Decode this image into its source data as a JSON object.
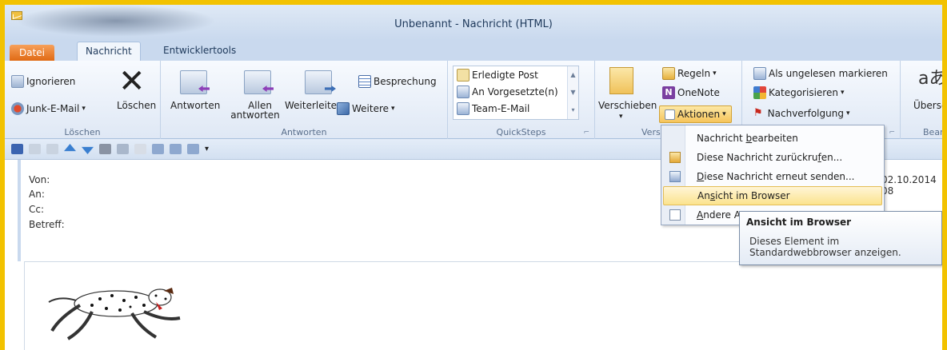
{
  "window": {
    "title": "Unbenannt - Nachricht (HTML)"
  },
  "tabs": [
    {
      "label": "Datei"
    },
    {
      "label": "Nachricht"
    },
    {
      "label": "Entwicklertools"
    }
  ],
  "ribbon": {
    "loeschen": {
      "group_label": "Löschen",
      "ignorieren": "Ignorieren",
      "junk": "Junk-E-Mail",
      "junk_arrow": "▾",
      "loeschen_btn": "Löschen"
    },
    "antworten": {
      "group_label": "Antworten",
      "antworten_btn": "Antworten",
      "allen_antworten_line1": "Allen",
      "allen_antworten_line2": "antworten",
      "weiterleiten": "Weiterleiten",
      "besprechung": "Besprechung",
      "weitere": "Weitere",
      "weitere_arrow": "▾"
    },
    "quicksteps": {
      "group_label": "QuickSteps",
      "items": [
        {
          "label": "Erledigte Post"
        },
        {
          "label": "An Vorgesetzte(n)"
        },
        {
          "label": "Team-E-Mail"
        }
      ],
      "launcher": "⌐"
    },
    "verschieben": {
      "group_label": "Versc",
      "verschieben_btn": "Verschieben",
      "regeln": "Regeln",
      "regeln_arrow": "▾",
      "onenote": "OneNote",
      "aktionen": "Aktionen",
      "aktionen_arrow": "▾"
    },
    "kategorien": {
      "group_label": "",
      "ungelesen": "Als ungelesen markieren",
      "kategorisieren": "Kategorisieren",
      "kategorisieren_arrow": "▾",
      "nachverfolgung": "Nachverfolgung",
      "nachverfolgung_arrow": "▾",
      "launcher": "⌐"
    },
    "bearbeiten": {
      "group_label": "Bear",
      "uebersetzen": "Überset"
    }
  },
  "message": {
    "from_label": "Von:",
    "to_label": "An:",
    "cc_label": "Cc:",
    "subject_label": "Betreff:",
    "date": "02.10.2014 08"
  },
  "menu": {
    "items": [
      {
        "label": "Nachricht bearbeiten",
        "pre": "Nachricht ",
        "ul": "b",
        "post": "earbeiten",
        "icon": "none"
      },
      {
        "label": "Diese Nachricht zurückrufen...",
        "pre": "Diese Nachricht zurückru",
        "ul": "f",
        "post": "en...",
        "icon": "recall-icon"
      },
      {
        "label": "Diese Nachricht erneut senden...",
        "pre": "",
        "ul": "D",
        "post": "iese Nachricht erneut senden...",
        "icon": "resend-icon"
      },
      {
        "label": "Ansicht im Browser",
        "pre": "An",
        "ul": "s",
        "post": "icht im Browser",
        "icon": "none",
        "highlighted": true
      },
      {
        "label": "Andere A",
        "pre": "",
        "ul": "A",
        "post": "ndere A",
        "icon": "other-actions-icon"
      }
    ]
  },
  "tooltip": {
    "title": "Ansicht im Browser",
    "body_line1": "Dieses Element im",
    "body_line2": "Standardwebbrowser anzeigen."
  },
  "colors": {
    "frame": "#f2c200",
    "accent_orange": "#e06a14",
    "highlight": "#fbe38e"
  }
}
